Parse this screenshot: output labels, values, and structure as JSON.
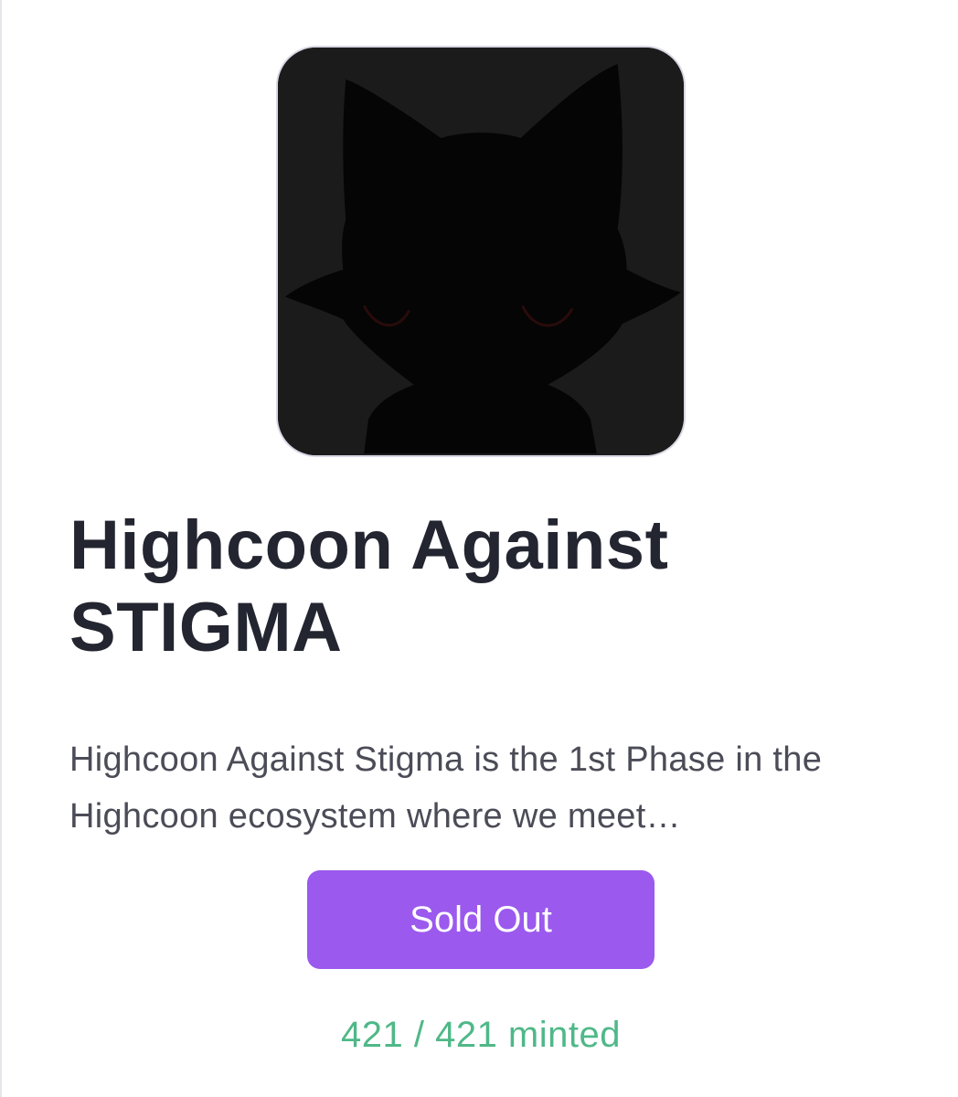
{
  "collection": {
    "title": "Highcoon Against STIGMA",
    "description": "Highcoon Against Stigma is the 1st Phase in the Highcoon ecosystem where we meet…",
    "artwork_icon": "silhouette-raccoon-icon"
  },
  "mint": {
    "button_label": "Sold Out",
    "status_text": "421 / 421 minted"
  },
  "colors": {
    "button": "#9b59ee",
    "minted_text": "#4fb888",
    "title_text": "#232530",
    "artwork_background": "#1b1b1b"
  }
}
